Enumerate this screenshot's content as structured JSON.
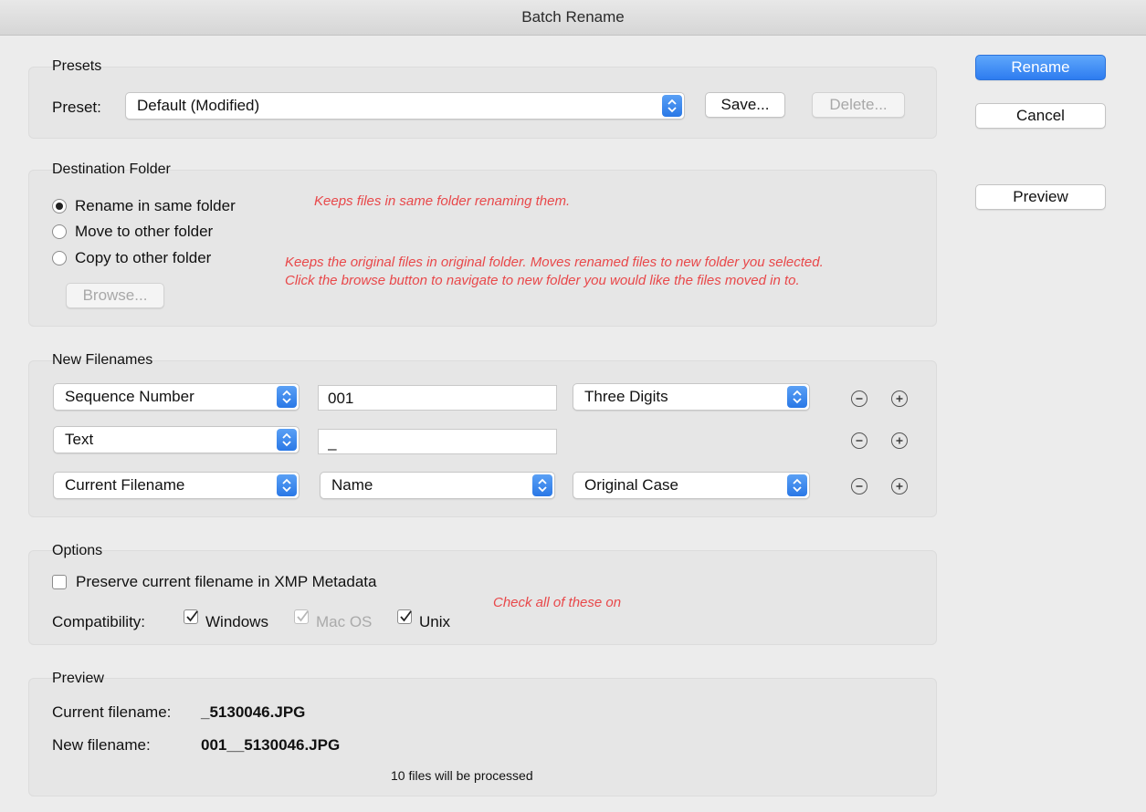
{
  "window": {
    "title": "Batch Rename"
  },
  "actions": {
    "rename": "Rename",
    "cancel": "Cancel",
    "preview": "Preview"
  },
  "presets": {
    "legend": "Presets",
    "label": "Preset:",
    "selected": "Default (Modified)",
    "save": "Save...",
    "delete": "Delete..."
  },
  "destination": {
    "legend": "Destination Folder",
    "options": [
      "Rename in same folder",
      "Move to other folder",
      "Copy to other folder"
    ],
    "selected_index": 0,
    "browse": "Browse...",
    "note1": "Keeps files in same folder renaming them.",
    "note2_line1": "Keeps the original files in original folder. Moves renamed files to new folder you selected.",
    "note2_line2": "Click the browse button to navigate to new folder you would like the files moved in to."
  },
  "new_filenames": {
    "legend": "New Filenames",
    "rows": [
      {
        "type": "Sequence Number",
        "value": "001",
        "format": "Three Digits"
      },
      {
        "type": "Text",
        "value": "_"
      },
      {
        "type": "Current Filename",
        "part": "Name",
        "format": "Original Case"
      }
    ]
  },
  "options": {
    "legend": "Options",
    "preserve_label": "Preserve current filename in XMP Metadata",
    "preserve_checked": false,
    "compat_label": "Compatibility:",
    "windows": "Windows",
    "macos": "Mac OS",
    "unix": "Unix",
    "windows_checked": true,
    "macos_checked": true,
    "unix_checked": true,
    "note": "Check all of these on"
  },
  "preview": {
    "legend": "Preview",
    "current_label": "Current filename:",
    "current_value": "_5130046.JPG",
    "new_label": "New filename:",
    "new_value": "001__5130046.JPG",
    "count_text": "10 files will be processed"
  },
  "colors": {
    "accent": "#2d7cf0",
    "note": "#e8484a"
  }
}
